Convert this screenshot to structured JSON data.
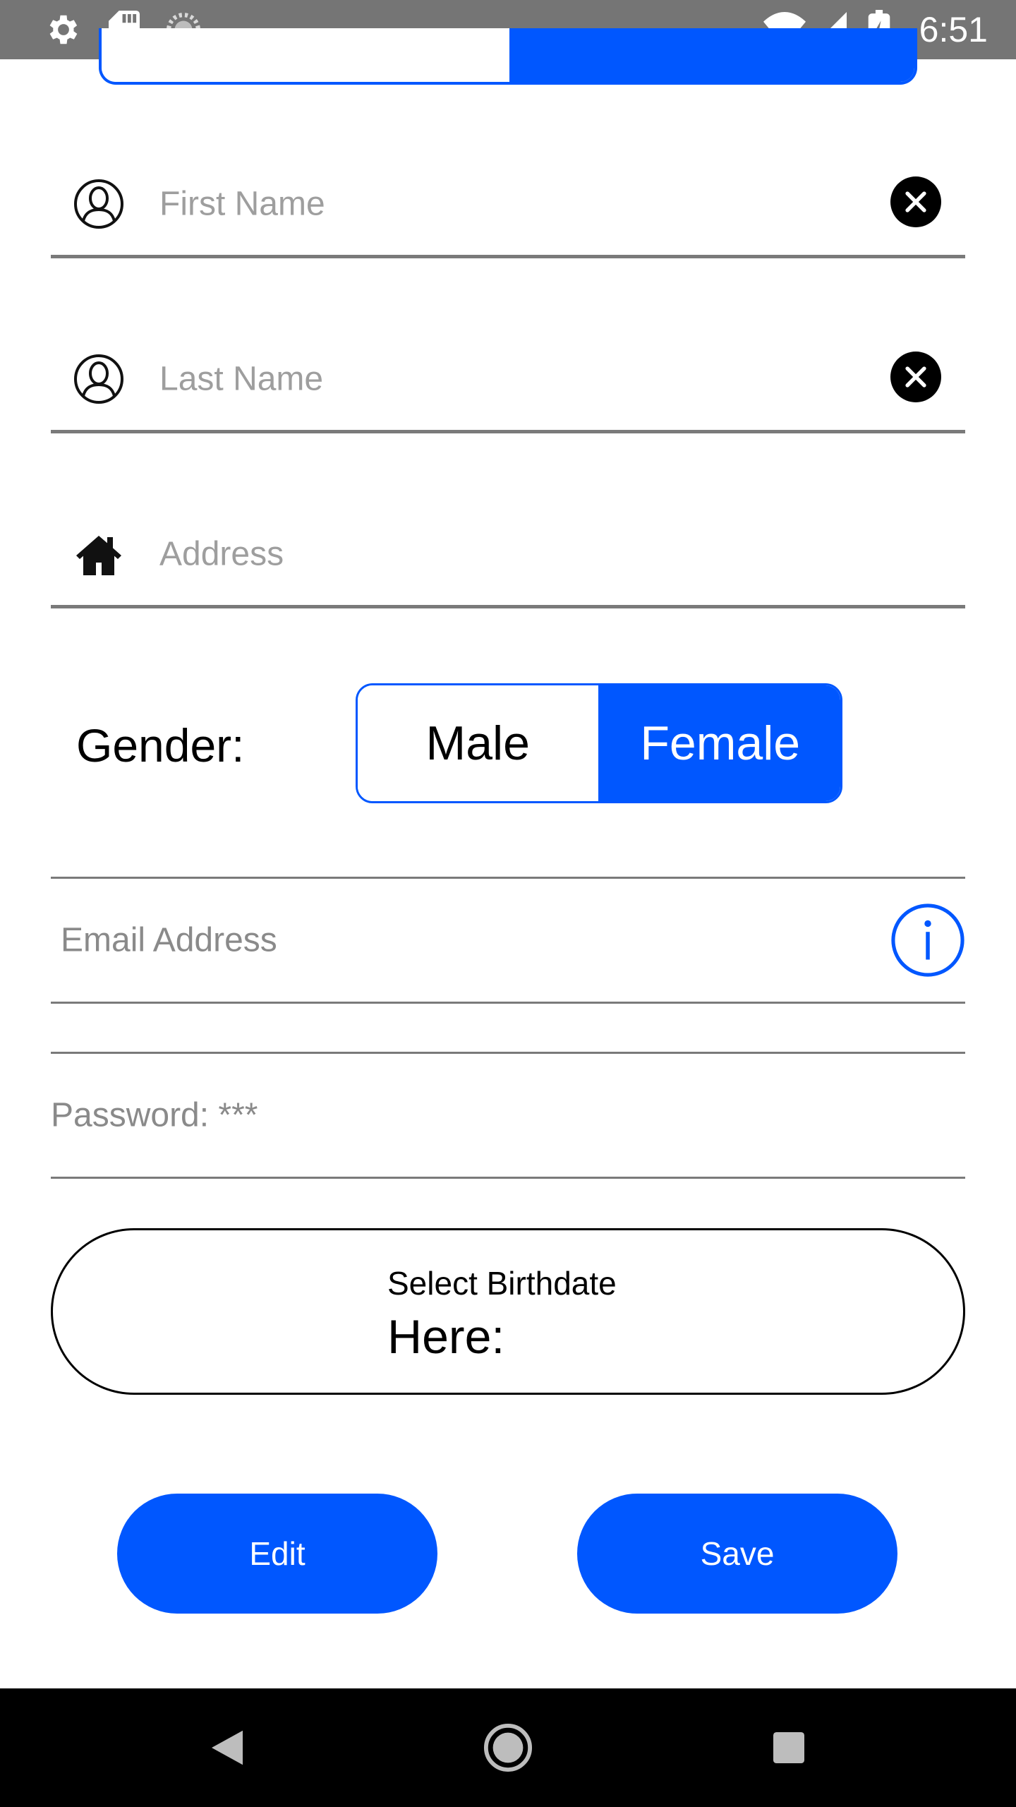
{
  "status_bar": {
    "time": "6:51",
    "icons": [
      "gear-icon",
      "sd-card-icon",
      "sync-icon",
      "wifi-icon",
      "signal-icon",
      "battery-charging-icon"
    ]
  },
  "form": {
    "first_name": {
      "placeholder": "First Name",
      "icon": "person-icon",
      "clear_icon": "close-icon"
    },
    "last_name": {
      "placeholder": "Last Name",
      "icon": "person-icon",
      "clear_icon": "close-icon"
    },
    "address": {
      "placeholder": "Address",
      "icon": "home-icon"
    },
    "gender": {
      "label": "Gender:",
      "options": [
        "Male",
        "Female"
      ],
      "selected": "Female"
    },
    "email": {
      "placeholder": "Email Address",
      "icon": "info-icon"
    },
    "password": {
      "text": "Password: ***"
    },
    "birthdate": {
      "line1": "Select Birthdate",
      "line2": "Here:"
    }
  },
  "actions": {
    "edit_label": "Edit",
    "save_label": "Save"
  },
  "nav": {
    "icons": [
      "back-icon",
      "home-icon",
      "recents-icon"
    ]
  },
  "colors": {
    "accent": "#0057ff",
    "status_bar": "#757575",
    "nav_bar": "#000000",
    "placeholder": "#9e9e9e"
  }
}
